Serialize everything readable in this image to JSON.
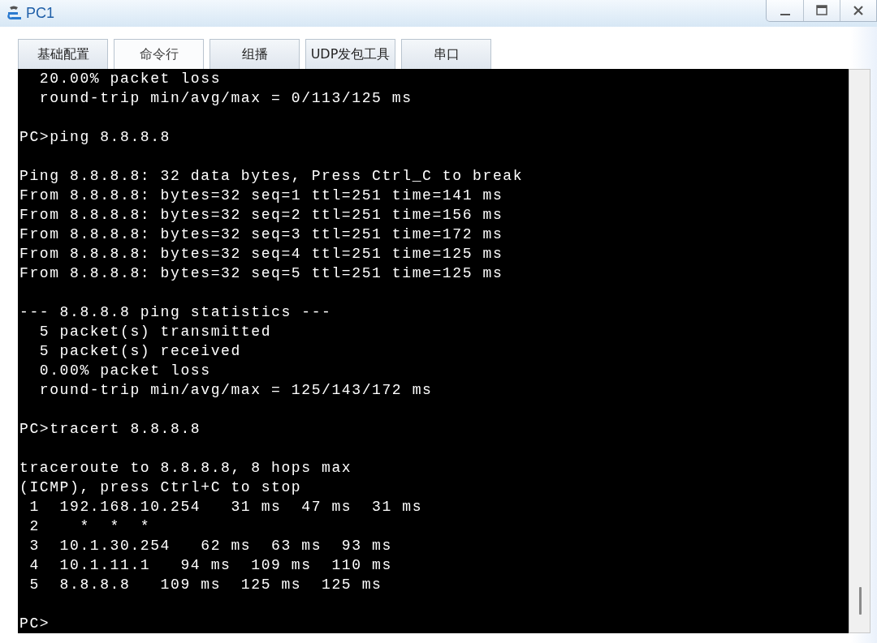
{
  "window": {
    "title": "PC1"
  },
  "tabs": [
    {
      "label": "基础配置",
      "selected": false
    },
    {
      "label": "命令行",
      "selected": true
    },
    {
      "label": "组播",
      "selected": false
    },
    {
      "label": "UDP发包工具",
      "selected": false
    },
    {
      "label": "串口",
      "selected": false
    }
  ],
  "terminal": {
    "blocks": [
      [
        "  20.00% packet loss",
        "  round-trip min/avg/max = 0/113/125 ms"
      ],
      [
        "PC>ping 8.8.8.8"
      ],
      [
        "Ping 8.8.8.8: 32 data bytes, Press Ctrl_C to break",
        "From 8.8.8.8: bytes=32 seq=1 ttl=251 time=141 ms",
        "From 8.8.8.8: bytes=32 seq=2 ttl=251 time=156 ms",
        "From 8.8.8.8: bytes=32 seq=3 ttl=251 time=172 ms",
        "From 8.8.8.8: bytes=32 seq=4 ttl=251 time=125 ms",
        "From 8.8.8.8: bytes=32 seq=5 ttl=251 time=125 ms"
      ],
      [
        "--- 8.8.8.8 ping statistics ---",
        "  5 packet(s) transmitted",
        "  5 packet(s) received",
        "  0.00% packet loss",
        "  round-trip min/avg/max = 125/143/172 ms"
      ],
      [
        "PC>tracert 8.8.8.8"
      ],
      [
        "traceroute to 8.8.8.8, 8 hops max",
        "(ICMP), press Ctrl+C to stop",
        " 1  192.168.10.254   31 ms  47 ms  31 ms",
        " 2    *  *  *",
        " 3  10.1.30.254   62 ms  63 ms  93 ms",
        " 4  10.1.11.1   94 ms  109 ms  110 ms",
        " 5  8.8.8.8   109 ms  125 ms  125 ms"
      ]
    ],
    "prompt": "PC>"
  }
}
